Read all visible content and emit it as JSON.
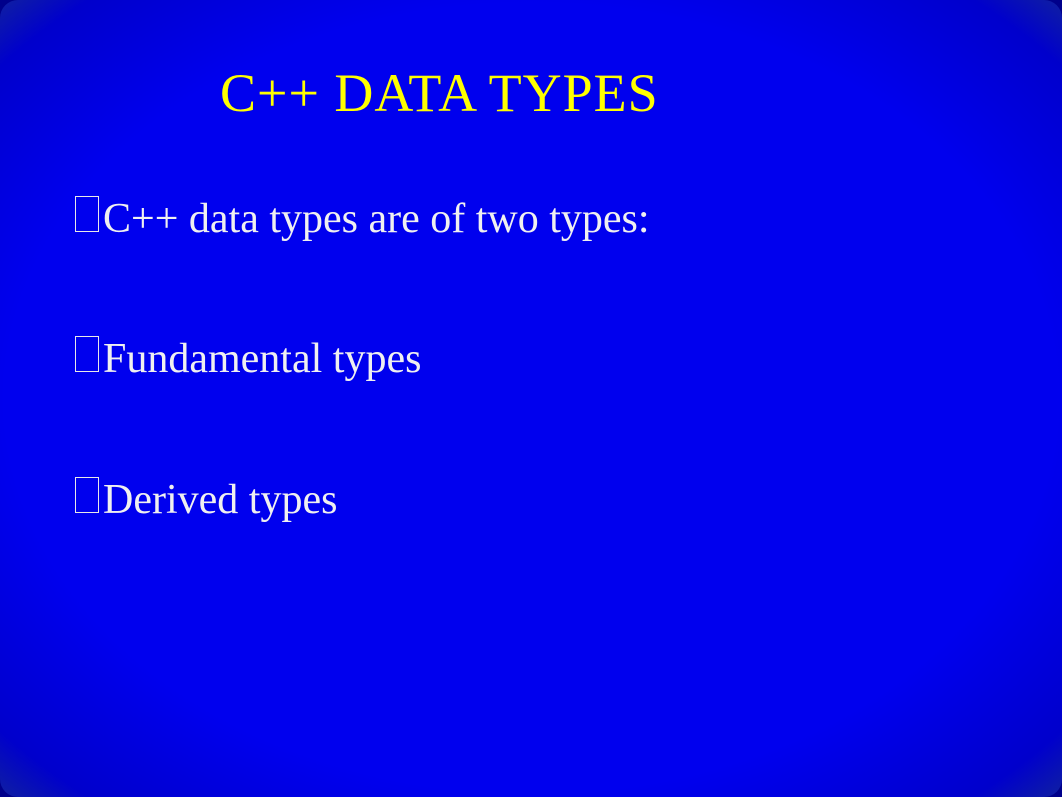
{
  "title": "C++ DATA TYPES",
  "bullets": [
    "C++ data types are of two types:",
    "Fundamental types",
    "Derived types"
  ],
  "colors": {
    "background": "#0000ee",
    "title": "#ffff00",
    "text": "#f0f0f0"
  }
}
